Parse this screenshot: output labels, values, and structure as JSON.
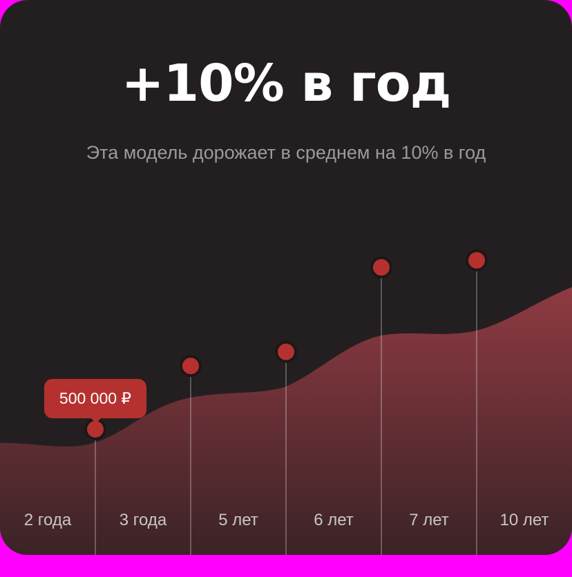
{
  "headline": "+10% в год",
  "subtitle": "Эта модель дорожает в среднем на 10% в год",
  "tooltip": "500 000 ₽",
  "colors": {
    "background": "#231f20",
    "accent": "#b5312f",
    "area_top": "#8f3a42",
    "headline": "#ffffff",
    "subtitle": "#9c9a9b",
    "labels": "#c9c6c7"
  },
  "chart_data": {
    "type": "area",
    "categories": [
      "2 года",
      "3 года",
      "5 лет",
      "6 лет",
      "7 лет",
      "10 лет"
    ],
    "markers": [
      {
        "category": "2 года",
        "level": 0.2
      },
      {
        "category": "3 года",
        "level": 0.38
      },
      {
        "category": "5 лет",
        "level": 0.42
      },
      {
        "category": "6 лет",
        "level": 0.66
      },
      {
        "category": "7 лет",
        "level": 0.68
      }
    ],
    "highlighted": {
      "category": "2 года",
      "label": "500 000 ₽"
    },
    "grid": false,
    "legend": "none"
  }
}
